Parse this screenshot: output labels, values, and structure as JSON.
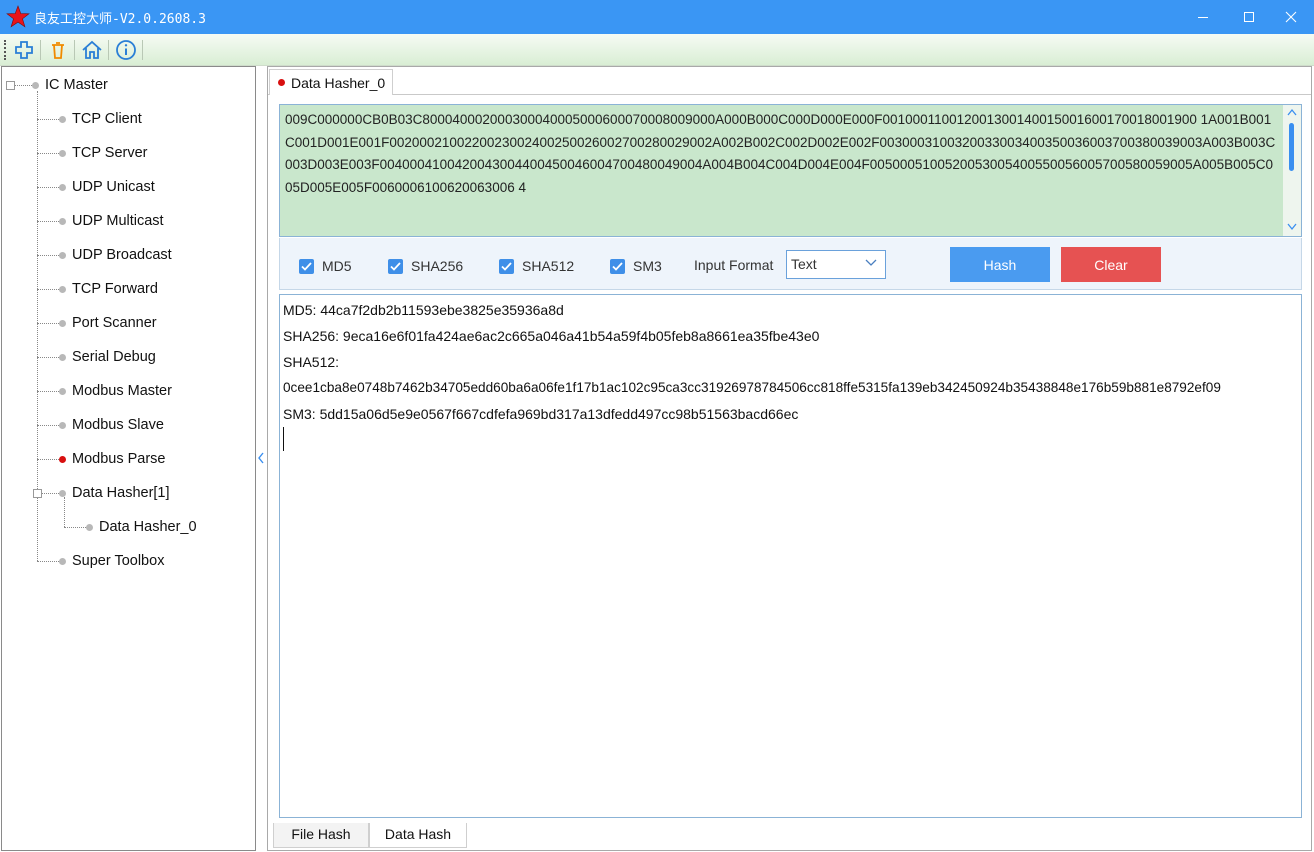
{
  "window": {
    "title": "良友工控大师-V2.0.2608.3",
    "logo_icon": "red-star-icon",
    "controls": [
      "minimize-icon",
      "maximize-icon",
      "close-icon"
    ]
  },
  "toolbar": {
    "buttons": [
      "add-icon",
      "delete-icon",
      "home-icon",
      "info-icon"
    ]
  },
  "tree": {
    "root": "IC Master",
    "items": [
      {
        "label": "TCP Client"
      },
      {
        "label": "TCP Server"
      },
      {
        "label": "UDP Unicast"
      },
      {
        "label": "UDP Multicast"
      },
      {
        "label": "UDP Broadcast"
      },
      {
        "label": "TCP Forward"
      },
      {
        "label": "Port Scanner"
      },
      {
        "label": "Serial Debug"
      },
      {
        "label": "Modbus Master"
      },
      {
        "label": "Modbus Slave"
      },
      {
        "label": "Modbus Parse"
      },
      {
        "label": "Data Hasher[1]"
      },
      {
        "label": "Data Hasher_0"
      },
      {
        "label": "Super Toolbox"
      }
    ]
  },
  "main": {
    "tab_label": "Data Hasher_0",
    "input_text": "009C000000CB0B03C800040002000300040005000600070008009000A000B000C000D000E000F001000110012001300140015001600170018001900 1A001B001C001D001E001F0020002100220023002400250026002700280029002A002B002C002D002E002F0030003100320033003400350036003700380039003A003B003C003D003E003F0040004100420043004400450046004700480049004A004B004C004D004E004F0050005100520053005400550056005700580059005A005B005C005D005E005F0060006100620063006 4",
    "options": {
      "md5": "MD5",
      "sha256": "SHA256",
      "sha512": "SHA512",
      "sm3": "SM3",
      "input_format_label": "Input Format",
      "input_format_value": "Text",
      "hash_button": "Hash",
      "clear_button": "Clear"
    },
    "output_lines": [
      "MD5: 44ca7f2db2b11593ebe3825e35936a8d",
      "SHA256: 9eca16e6f01fa424ae6ac2c665a046a41b54a59f4b05feb8a8661ea35fbe43e0",
      "SHA512:",
      "0cee1cba8e0748b7462b34705edd60ba6a06fe1f17b1ac102c95ca3cc31926978784506cc818ffe5315fa139eb342450924b35438848e176b59b881e8792ef09",
      "SM3: 5dd15a06d5e9e0567f667cdfefa969bd317a13dfedd497cc98b51563bacd66ec"
    ],
    "bottom_tabs": [
      "File Hash",
      "Data Hash"
    ]
  }
}
